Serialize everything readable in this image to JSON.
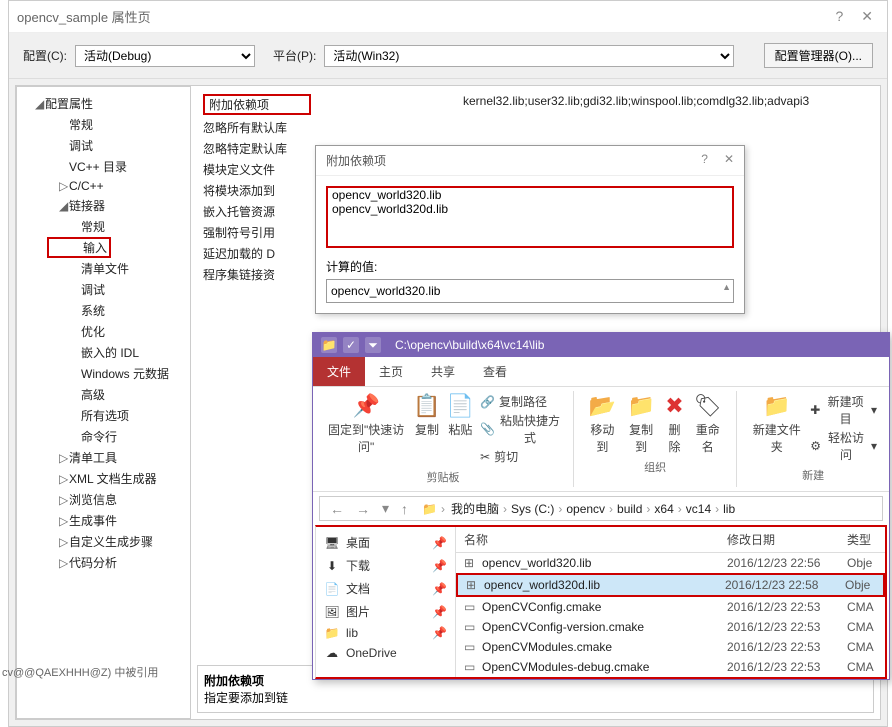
{
  "main_window": {
    "title": "opencv_sample 属性页",
    "config_label": "配置(C):",
    "config_value": "活动(Debug)",
    "platform_label": "平台(P):",
    "platform_value": "活动(Win32)",
    "config_manager_btn": "配置管理器(O)..."
  },
  "tree": {
    "root": "配置属性",
    "items": [
      {
        "label": "常规",
        "indent": 1
      },
      {
        "label": "调试",
        "indent": 1
      },
      {
        "label": "VC++ 目录",
        "indent": 1
      },
      {
        "label": "C/C++",
        "indent": 1,
        "marker": "▷"
      },
      {
        "label": "链接器",
        "indent": 1,
        "marker": "◢"
      },
      {
        "label": "常规",
        "indent": 2
      },
      {
        "label": "输入",
        "indent": 2,
        "selected": true
      },
      {
        "label": "清单文件",
        "indent": 2
      },
      {
        "label": "调试",
        "indent": 2
      },
      {
        "label": "系统",
        "indent": 2
      },
      {
        "label": "优化",
        "indent": 2
      },
      {
        "label": "嵌入的 IDL",
        "indent": 2
      },
      {
        "label": "Windows 元数据",
        "indent": 2
      },
      {
        "label": "高级",
        "indent": 2
      },
      {
        "label": "所有选项",
        "indent": 2
      },
      {
        "label": "命令行",
        "indent": 2
      },
      {
        "label": "清单工具",
        "indent": 1,
        "marker": "▷"
      },
      {
        "label": "XML 文档生成器",
        "indent": 1,
        "marker": "▷"
      },
      {
        "label": "浏览信息",
        "indent": 1,
        "marker": "▷"
      },
      {
        "label": "生成事件",
        "indent": 1,
        "marker": "▷"
      },
      {
        "label": "自定义生成步骤",
        "indent": 1,
        "marker": "▷"
      },
      {
        "label": "代码分析",
        "indent": 1,
        "marker": "▷"
      }
    ]
  },
  "props": [
    {
      "label": "附加依赖项",
      "value": "kernel32.lib;user32.lib;gdi32.lib;winspool.lib;comdlg32.lib;advapi3",
      "highlighted": true
    },
    {
      "label": "忽略所有默认库"
    },
    {
      "label": "忽略特定默认库"
    },
    {
      "label": "模块定义文件"
    },
    {
      "label": "将模块添加到"
    },
    {
      "label": "嵌入托管资源"
    },
    {
      "label": "强制符号引用"
    },
    {
      "label": "延迟加载的 D"
    },
    {
      "label": "程序集链接资"
    }
  ],
  "bottom_block": {
    "hdr": "附加依赖项",
    "desc": "指定要添加到链"
  },
  "small_dialog": {
    "title": "附加依赖项",
    "lines": [
      "opencv_world320.lib",
      "opencv_world320d.lib"
    ],
    "calc_label": "计算的值:",
    "calc_value": "opencv_world320.lib"
  },
  "explorer": {
    "path_title": "C:\\opencv\\build\\x64\\vc14\\lib",
    "menu": [
      "文件",
      "主页",
      "共享",
      "查看"
    ],
    "active_menu": 0,
    "ribbon": {
      "pin": "固定到\"快速访问\"",
      "copy": "复制",
      "paste": "粘贴",
      "copypath": "复制路径",
      "pasteshortcut": "粘贴快捷方式",
      "cut": "剪切",
      "clipboard_caption": "剪贴板",
      "moveto": "移动到",
      "copyto": "复制到",
      "delete": "删除",
      "rename": "重命名",
      "organize_caption": "组织",
      "newfolder": "新建文件夹",
      "newitem": "新建项目",
      "easyaccess": "轻松访问",
      "new_caption": "新建"
    },
    "breadcrumbs": [
      "我的电脑",
      "Sys (C:)",
      "opencv",
      "build",
      "x64",
      "vc14",
      "lib"
    ],
    "side_items": [
      {
        "icon": "🖥",
        "label": "桌面"
      },
      {
        "icon": "⬇",
        "label": "下载"
      },
      {
        "icon": "📄",
        "label": "文档"
      },
      {
        "icon": "🖼",
        "label": "图片"
      },
      {
        "icon": "📁",
        "label": "lib"
      },
      {
        "icon": "☁",
        "label": "OneDrive",
        "nopin": true
      }
    ],
    "columns": {
      "name": "名称",
      "date": "修改日期",
      "type": "类型"
    },
    "files": [
      {
        "icon": "⊞",
        "name": "opencv_world320.lib",
        "date": "2016/12/23 22:56",
        "type": "Obje"
      },
      {
        "icon": "⊞",
        "name": "opencv_world320d.lib",
        "date": "2016/12/23 22:58",
        "type": "Obje",
        "selected": true,
        "highlighted": true
      },
      {
        "icon": "▭",
        "name": "OpenCVConfig.cmake",
        "date": "2016/12/23 22:53",
        "type": "CMA"
      },
      {
        "icon": "▭",
        "name": "OpenCVConfig-version.cmake",
        "date": "2016/12/23 22:53",
        "type": "CMA"
      },
      {
        "icon": "▭",
        "name": "OpenCVModules.cmake",
        "date": "2016/12/23 22:53",
        "type": "CMA"
      },
      {
        "icon": "▭",
        "name": "OpenCVModules-debug.cmake",
        "date": "2016/12/23 22:53",
        "type": "CMA"
      }
    ]
  },
  "bottom_text": "cv@@QAEXHHH@Z) 中被引用"
}
